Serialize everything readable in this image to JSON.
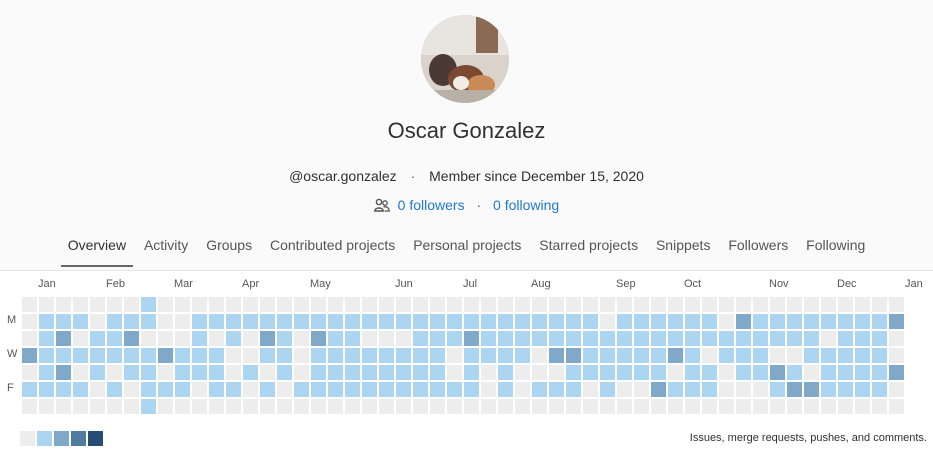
{
  "profile": {
    "name": "Oscar Gonzalez",
    "username": "@oscar.gonzalez",
    "member_since": "Member since December 15, 2020",
    "followers": "0 followers",
    "following": "0 following",
    "avatar_icon": "user-avatar-photo"
  },
  "tabs": [
    {
      "label": "Overview",
      "active": true
    },
    {
      "label": "Activity"
    },
    {
      "label": "Groups"
    },
    {
      "label": "Contributed projects"
    },
    {
      "label": "Personal projects"
    },
    {
      "label": "Starred projects"
    },
    {
      "label": "Snippets"
    },
    {
      "label": "Followers"
    },
    {
      "label": "Following"
    }
  ],
  "calendar": {
    "months": [
      "Jan",
      "Feb",
      "Mar",
      "Apr",
      "May",
      "Jun",
      "Jul",
      "Aug",
      "Sep",
      "Oct",
      "Nov",
      "Dec",
      "Jan"
    ],
    "day_labels": [
      "M",
      "W",
      "F"
    ],
    "legend_text": "Issues, merge requests, pushes, and comments.",
    "colors": [
      "#ededed",
      "#acd5f2",
      "#7fa8c9",
      "#527ba0",
      "#254e77"
    ],
    "levels_by_row": [
      "0000000100000000000000000000000000000000000000000000",
      "0111011100111111111111111111111111011111102111111112",
      "0120112000101021021100011121111111111111111111101110",
      "2111111121110011011111111011110221111121011100111110",
      "0120101101110101011111111010100011111101101121011112",
      "1111010111011010111111111110101110100211100012211110",
      "0000000100000000000000000000000000000000000000000000"
    ]
  }
}
